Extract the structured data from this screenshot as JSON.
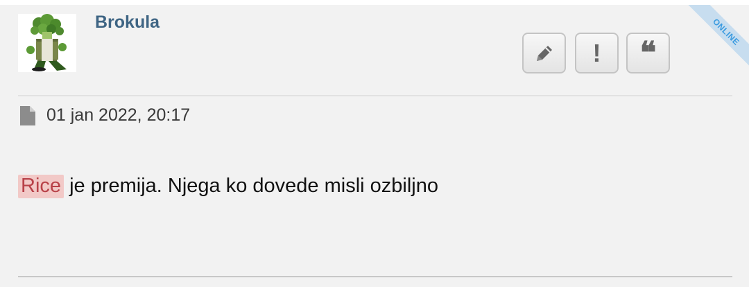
{
  "post": {
    "username": "Brokula",
    "status_ribbon": "ONLINE",
    "date": "01 jan 2022, 20:17",
    "mention": "Rice",
    "content_text": " je premija. Njega ko dovede misli ozbiljno"
  },
  "actions": {
    "edit_icon": "pencil-icon",
    "report_icon": "exclamation-icon",
    "report_label": "!",
    "quote_icon": "quote-icon",
    "quote_label": "❝"
  },
  "colors": {
    "username": "#3f6584",
    "mention_bg": "#f2c9c7",
    "mention_text": "#b84148",
    "ribbon_bg": "#c7ddef",
    "ribbon_text": "#3b9be0"
  }
}
